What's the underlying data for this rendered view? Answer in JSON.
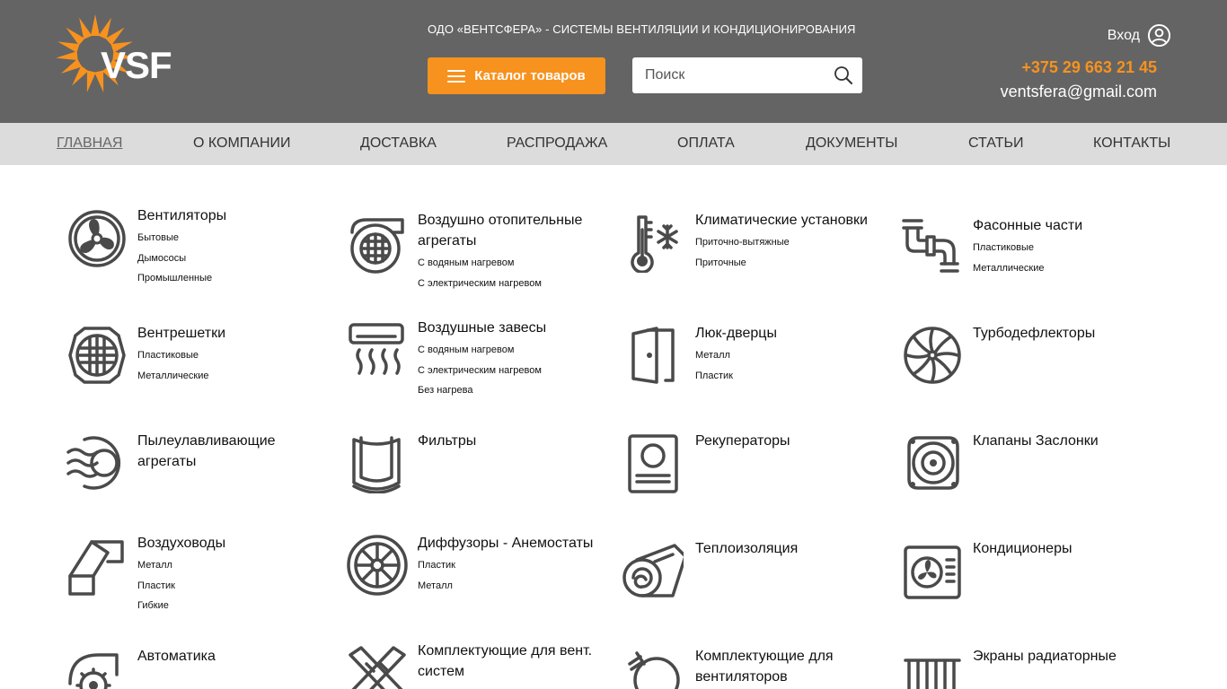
{
  "brand": {
    "logo_text": "VSF",
    "tagline": "ОДО «ВЕНТСФЕРА» - СИСТЕМЫ ВЕНТИЛЯЦИИ И КОНДИЦИОНИРОВАНИЯ",
    "accent_color": "#f7921e",
    "header_color": "#646464"
  },
  "header": {
    "catalog_button": "Каталог товаров",
    "search_placeholder": "Поиск",
    "login_label": "Вход",
    "phone": "+375 29 663 21 45",
    "email": "ventsfera@gmail.com"
  },
  "nav": {
    "items": [
      {
        "label": "ГЛАВНАЯ",
        "active": true
      },
      {
        "label": "О КОМПАНИИ"
      },
      {
        "label": "ДОСТАВКА"
      },
      {
        "label": "РАСПРОДАЖА"
      },
      {
        "label": "ОПЛАТА"
      },
      {
        "label": "ДОКУМЕНТЫ"
      },
      {
        "label": "СТАТЬИ"
      },
      {
        "label": "КОНТАКТЫ"
      }
    ]
  },
  "catalog": {
    "items": [
      {
        "title": "Вентиляторы",
        "icon": "fan-icon",
        "subs": [
          "Бытовые",
          "Дымососы",
          "Промышленные"
        ]
      },
      {
        "title": "Воздушно отопительные агрегаты",
        "icon": "air-heater-icon",
        "subs": [
          "С водяным нагревом",
          "С электрическим нагревом"
        ]
      },
      {
        "title": "Климатические установки",
        "icon": "thermometer-snowflake-icon",
        "subs": [
          "Приточно-вытяжные",
          "Приточные"
        ]
      },
      {
        "title": "Фасонные части",
        "icon": "pipe-fittings-icon",
        "subs": [
          "Пластиковые",
          "Металлические"
        ]
      },
      {
        "title": "Вентрешетки",
        "icon": "vent-grille-icon",
        "subs": [
          "Пластиковые",
          "Металлические"
        ]
      },
      {
        "title": "Воздушные завесы",
        "icon": "air-curtain-icon",
        "subs": [
          "С водяным нагревом",
          "С электрическим нагревом",
          "Без нагрева"
        ]
      },
      {
        "title": "Люк-дверцы",
        "icon": "door-icon",
        "subs": [
          "Металл",
          "Пластик"
        ]
      },
      {
        "title": "Турбодефлекторы",
        "icon": "turbine-icon",
        "subs": []
      },
      {
        "title": "Пылеулавливающие агрегаты",
        "icon": "dust-collector-icon",
        "subs": []
      },
      {
        "title": "Фильтры",
        "icon": "filter-icon",
        "subs": []
      },
      {
        "title": "Рекуператоры",
        "icon": "recuperator-icon",
        "subs": []
      },
      {
        "title": "Клапаны Заслонки",
        "icon": "valve-icon",
        "subs": []
      },
      {
        "title": "Воздуховоды",
        "icon": "duct-icon",
        "subs": [
          "Металл",
          "Пластик",
          "Гибкие"
        ]
      },
      {
        "title": "Диффузоры - Анемостаты",
        "icon": "diffuser-icon",
        "subs": [
          "Пластик",
          "Металл"
        ]
      },
      {
        "title": "Теплоизоляция",
        "icon": "insulation-roll-icon",
        "subs": []
      },
      {
        "title": "Кондиционеры",
        "icon": "air-conditioner-icon",
        "subs": []
      },
      {
        "title": "Автоматика",
        "icon": "automation-gear-icon",
        "subs": []
      },
      {
        "title": "Комплектующие для вент. систем",
        "icon": "components-icon",
        "subs": []
      },
      {
        "title": "Комплектующие для вентиляторов",
        "icon": "clamp-icon",
        "subs": []
      },
      {
        "title": "Экраны радиаторные",
        "icon": "radiator-screen-icon",
        "subs": []
      }
    ]
  }
}
